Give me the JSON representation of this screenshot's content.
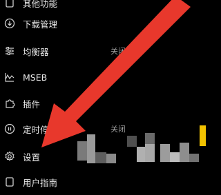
{
  "menu": {
    "items": [
      {
        "label": "其他功能",
        "icon": "document-icon",
        "value": ""
      },
      {
        "label": "下载管理",
        "icon": "download-icon",
        "value": ""
      },
      {
        "label": "均衡器",
        "icon": "equalizer-icon",
        "value": "关闭"
      },
      {
        "label": "MSEB",
        "icon": "waveform-icon",
        "value": ""
      },
      {
        "label": "插件",
        "icon": "puzzle-icon",
        "value": ""
      },
      {
        "label": "定时停",
        "icon": "timer-icon",
        "value": "关闭"
      },
      {
        "label": "设置",
        "icon": "settings-icon",
        "value": ""
      },
      {
        "label": "用户指南",
        "icon": "guide-icon",
        "value": ""
      }
    ]
  },
  "colors": {
    "background": "#000000",
    "text": "#e8e8e8",
    "muted": "#9a9a9a",
    "arrow": "#e8382c",
    "accent": "#f2c200"
  }
}
